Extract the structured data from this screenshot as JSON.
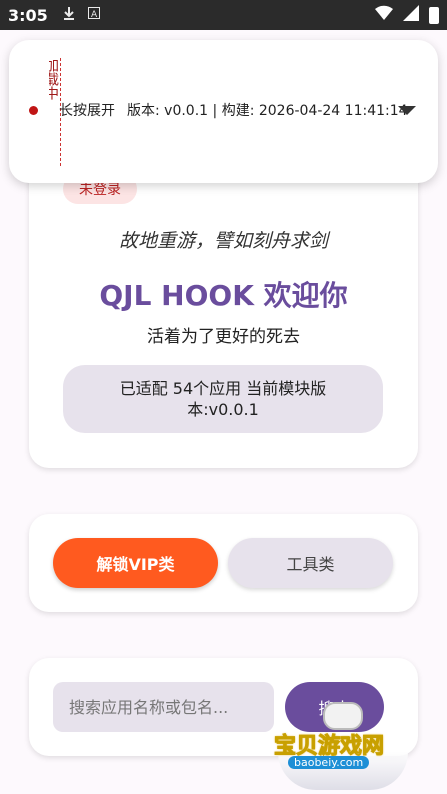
{
  "status_bar": {
    "time": "3:05",
    "icons": [
      "download-icon",
      "a-icon",
      "wifi-icon",
      "signal-icon",
      "battery-icon"
    ]
  },
  "overlay": {
    "vertical_text": "加载中…",
    "hint": "长按展开",
    "version": "版本: v0.0.1 | 构建: 2026-04-24 11:41:14",
    "accent": "#c01515"
  },
  "welcome_card": {
    "login_badge": "未登录",
    "motto": "故地重游，譬如刻舟求剑",
    "title": "QJL HOOK 欢迎你",
    "subtitle": "活着为了更好的死去",
    "info": "已适配 54个应用  当前模块版本:v0.0.1",
    "title_color": "#6a4d9d"
  },
  "category_tabs": {
    "vip_label": "解锁VIP类",
    "tools_label": "工具类",
    "active_color": "#ff5a1f"
  },
  "search": {
    "placeholder": "搜索应用名称或包名...",
    "button_label": "搜索"
  },
  "watermark": {
    "text": "宝贝游戏网",
    "url": "baobeiy.com"
  }
}
